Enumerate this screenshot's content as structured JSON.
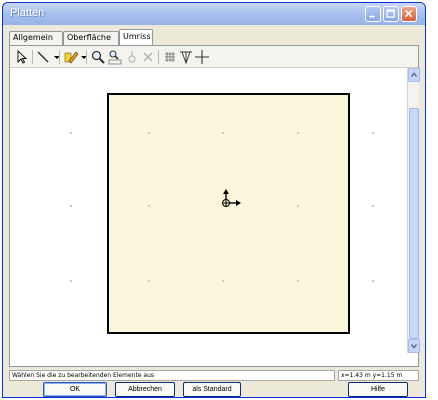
{
  "window": {
    "title": "Platten",
    "minimize_icon": "minimize-icon",
    "maximize_icon": "maximize-icon",
    "close_icon": "close-icon"
  },
  "tabs": [
    {
      "label": "Allgemein"
    },
    {
      "label": "Oberfläche"
    },
    {
      "label": "Umriss",
      "selected": true
    }
  ],
  "toolbar": {
    "tools": [
      {
        "icon": "pointer-arrow-icon"
      },
      {
        "icon": "line-tool-icon"
      },
      {
        "icon": "pencil-tool-icon"
      },
      {
        "icon": "zoom-icon"
      },
      {
        "icon": "zoom-all-icon"
      },
      {
        "icon": "move-point-icon"
      },
      {
        "icon": "delete-icon"
      },
      {
        "icon": "grid-icon"
      },
      {
        "icon": "snap-icon"
      },
      {
        "icon": "crosshair-icon"
      }
    ]
  },
  "status": {
    "message": "Wählen Sie die zu bearbeitenden Elemente aus",
    "coords": "x=1.43 m  y=1.15 m"
  },
  "buttons": {
    "ok": "OK",
    "cancel": "Abbrechen",
    "standard": "als Standard",
    "help": "Hilfe"
  }
}
